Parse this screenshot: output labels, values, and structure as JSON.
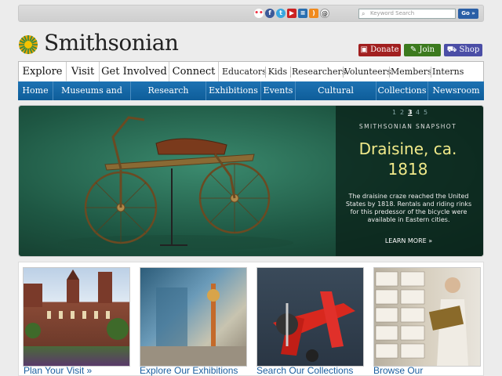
{
  "search": {
    "placeholder": "Keyword Search",
    "go_label": "Go »"
  },
  "social": [
    "flickr-icon",
    "facebook-icon",
    "twitter-icon",
    "youtube-icon",
    "blog-icon",
    "rss-icon",
    "email-icon"
  ],
  "brand": {
    "name": "Smithsonian"
  },
  "actions": {
    "donate": "Donate",
    "join": "Join",
    "shop": "Shop"
  },
  "nav_primary": [
    "Explore",
    "Visit",
    "Get Involved",
    "Connect"
  ],
  "nav_audience": [
    "Educators",
    "Kids",
    "Researchers",
    "Volunteers",
    "Members",
    "Interns"
  ],
  "nav_secondary": [
    "Home",
    "Museums and Zoo",
    "Research Centers",
    "Exhibitions",
    "Events",
    "Cultural Programs",
    "Collections",
    "Newsroom"
  ],
  "hero": {
    "pager": [
      "1",
      "2",
      "3",
      "4",
      "5"
    ],
    "active_page": "3",
    "kicker": "SMITHSONIAN SNAPSHOT",
    "title_line1": "Draisine, ca.",
    "title_line2": "1818",
    "description": "The draisine craze reached the United States by 1818. Rentals and riding rinks for this predessor of the bicycle were available in Eastern cities.",
    "cta": "LEARN MORE »"
  },
  "tiles": [
    {
      "caption": "Plan Your Visit »"
    },
    {
      "caption": "Explore Our Exhibitions"
    },
    {
      "caption": "Search Our Collections"
    },
    {
      "caption": "Browse Our"
    }
  ],
  "colors": {
    "accent": "#1a5fa0",
    "hero_title": "#f1ea8a",
    "donate": "#a11f1f",
    "join": "#3c7a1e",
    "shop": "#4b4ea6"
  }
}
